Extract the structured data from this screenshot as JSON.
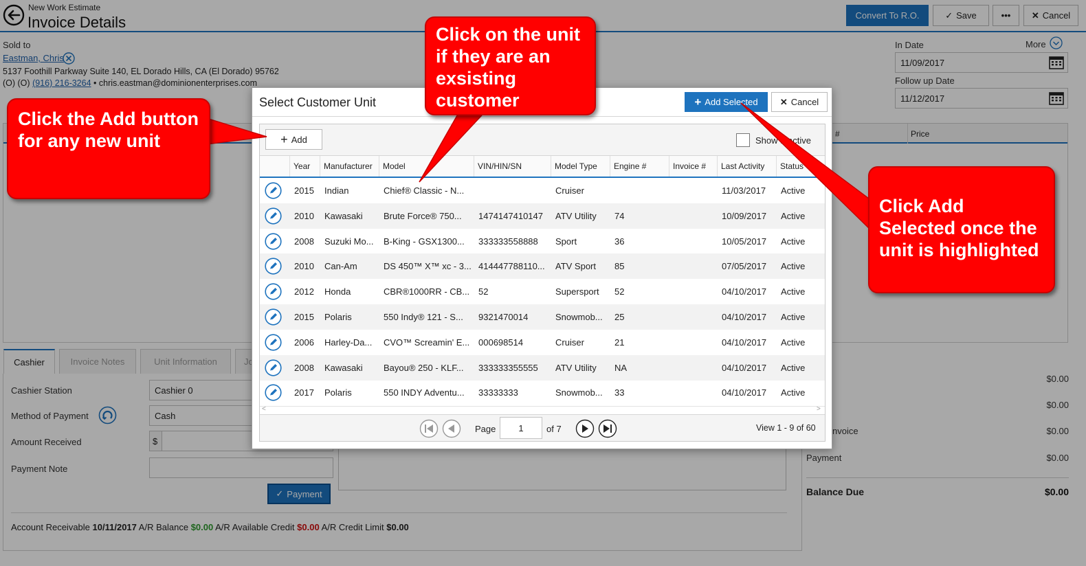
{
  "header": {
    "subtitle": "New Work Estimate",
    "title": "Invoice Details",
    "convert_label": "Convert To R.O.",
    "save_label": "Save",
    "more_menu_label": "•••",
    "cancel_label": "Cancel"
  },
  "customer": {
    "sold_to_label": "Sold to",
    "name": "Eastman, Chris",
    "address": "5137 Foothill Parkway Suite 140, EL Dorado Hills, CA (El Dorado) 95762",
    "phone_prefix": "(O) (O)",
    "phone": "(916) 216-3264",
    "email_prefix": "•",
    "email": "chris.eastman@dominionenterprises.com"
  },
  "dates": {
    "more_label": "More",
    "in_date_label": "In Date",
    "in_date_value": "11/09/2017",
    "follow_up_label": "Follow up Date",
    "follow_up_value": "11/12/2017"
  },
  "lines_table": {
    "col_hash": "#",
    "col_price": "Price"
  },
  "tabs": [
    "Cashier",
    "Invoice Notes",
    "Unit Information",
    "Jo"
  ],
  "cashier": {
    "station_label": "Cashier Station",
    "station_value": "Cashier 0",
    "method_label": "Method of Payment",
    "method_value": "Cash",
    "amount_label": "Amount Received",
    "currency_symbol": "$",
    "amount_value": "",
    "note_label": "Payment Note",
    "note_value": "",
    "payment_button": "Payment"
  },
  "account": {
    "ar_label": "Account Receivable",
    "ar_date": "10/11/2017",
    "balance_label": "A/R Balance",
    "balance_value": "$0.00",
    "available_label": "A/R Available Credit",
    "available_value": "$0.00",
    "limit_label": "A/R Credit Limit",
    "limit_value": "$0.00"
  },
  "summary": {
    "row1_value": "$0.00",
    "row2_value": "$0.00",
    "row3_label": "nvoice",
    "row3_value": "$0.00",
    "row4_label": "Payment",
    "row4_value": "$0.00",
    "balance_label": "Balance Due",
    "balance_value": "$0.00"
  },
  "modal": {
    "title": "Select Customer Unit",
    "add_selected_label": "Add Selected",
    "cancel_label": "Cancel",
    "add_label": "Add",
    "show_inactive_label": "Show Inactive",
    "columns": [
      "Year",
      "Manufacturer",
      "Model",
      "VIN/HIN/SN",
      "Model Type",
      "Engine #",
      "Invoice #",
      "Last Activity",
      "Status"
    ],
    "rows": [
      {
        "year": "2015",
        "manufacturer": "Indian",
        "model": "Chief® Classic - N...",
        "vin": "",
        "model_type": "Cruiser",
        "engine": "",
        "invoice": "",
        "last_activity": "11/03/2017",
        "status": "Active"
      },
      {
        "year": "2010",
        "manufacturer": "Kawasaki",
        "model": "Brute Force® 750...",
        "vin": "1474147410147",
        "model_type": "ATV Utility",
        "engine": "74",
        "invoice": "",
        "last_activity": "10/09/2017",
        "status": "Active"
      },
      {
        "year": "2008",
        "manufacturer": "Suzuki Mo...",
        "model": "B-King - GSX1300...",
        "vin": "333333558888",
        "model_type": "Sport",
        "engine": "36",
        "invoice": "",
        "last_activity": "10/05/2017",
        "status": "Active"
      },
      {
        "year": "2010",
        "manufacturer": "Can-Am",
        "model": "DS 450™ X™ xc - 3...",
        "vin": "414447788110...",
        "model_type": "ATV Sport",
        "engine": "85",
        "invoice": "",
        "last_activity": "07/05/2017",
        "status": "Active"
      },
      {
        "year": "2012",
        "manufacturer": "Honda",
        "model": "CBR®1000RR - CB...",
        "vin": "52",
        "model_type": "Supersport",
        "engine": "52",
        "invoice": "",
        "last_activity": "04/10/2017",
        "status": "Active"
      },
      {
        "year": "2015",
        "manufacturer": "Polaris",
        "model": "550 Indy® 121 - S...",
        "vin": "9321470014",
        "model_type": "Snowmob...",
        "engine": "25",
        "invoice": "",
        "last_activity": "04/10/2017",
        "status": "Active"
      },
      {
        "year": "2006",
        "manufacturer": "Harley-Da...",
        "model": "CVO™ Screamin' E...",
        "vin": "000698514",
        "model_type": "Cruiser",
        "engine": "21",
        "invoice": "",
        "last_activity": "04/10/2017",
        "status": "Active"
      },
      {
        "year": "2008",
        "manufacturer": "Kawasaki",
        "model": "Bayou® 250 - KLF...",
        "vin": "333333355555",
        "model_type": "ATV Utility",
        "engine": "NA",
        "invoice": "",
        "last_activity": "04/10/2017",
        "status": "Active"
      },
      {
        "year": "2017",
        "manufacturer": "Polaris",
        "model": "550 INDY Adventu...",
        "vin": "33333333",
        "model_type": "Snowmob...",
        "engine": "33",
        "invoice": "",
        "last_activity": "04/10/2017",
        "status": "Active"
      }
    ],
    "pager": {
      "page_label": "Page",
      "page_value": "1",
      "of_label": "of 7",
      "view_label": "View 1 - 9 of 60"
    }
  },
  "callouts": {
    "add_button_tip": "Click the Add button for any new unit",
    "existing_unit_tip": "Click on the unit if they are an exsisting customer",
    "add_selected_tip": "Click Add Selected once the unit is highlighted"
  },
  "colors": {
    "accent_blue": "#1e73be",
    "callout_red": "#ff0000",
    "ar_green": "#2e9a2e",
    "ar_red": "#d01010"
  }
}
